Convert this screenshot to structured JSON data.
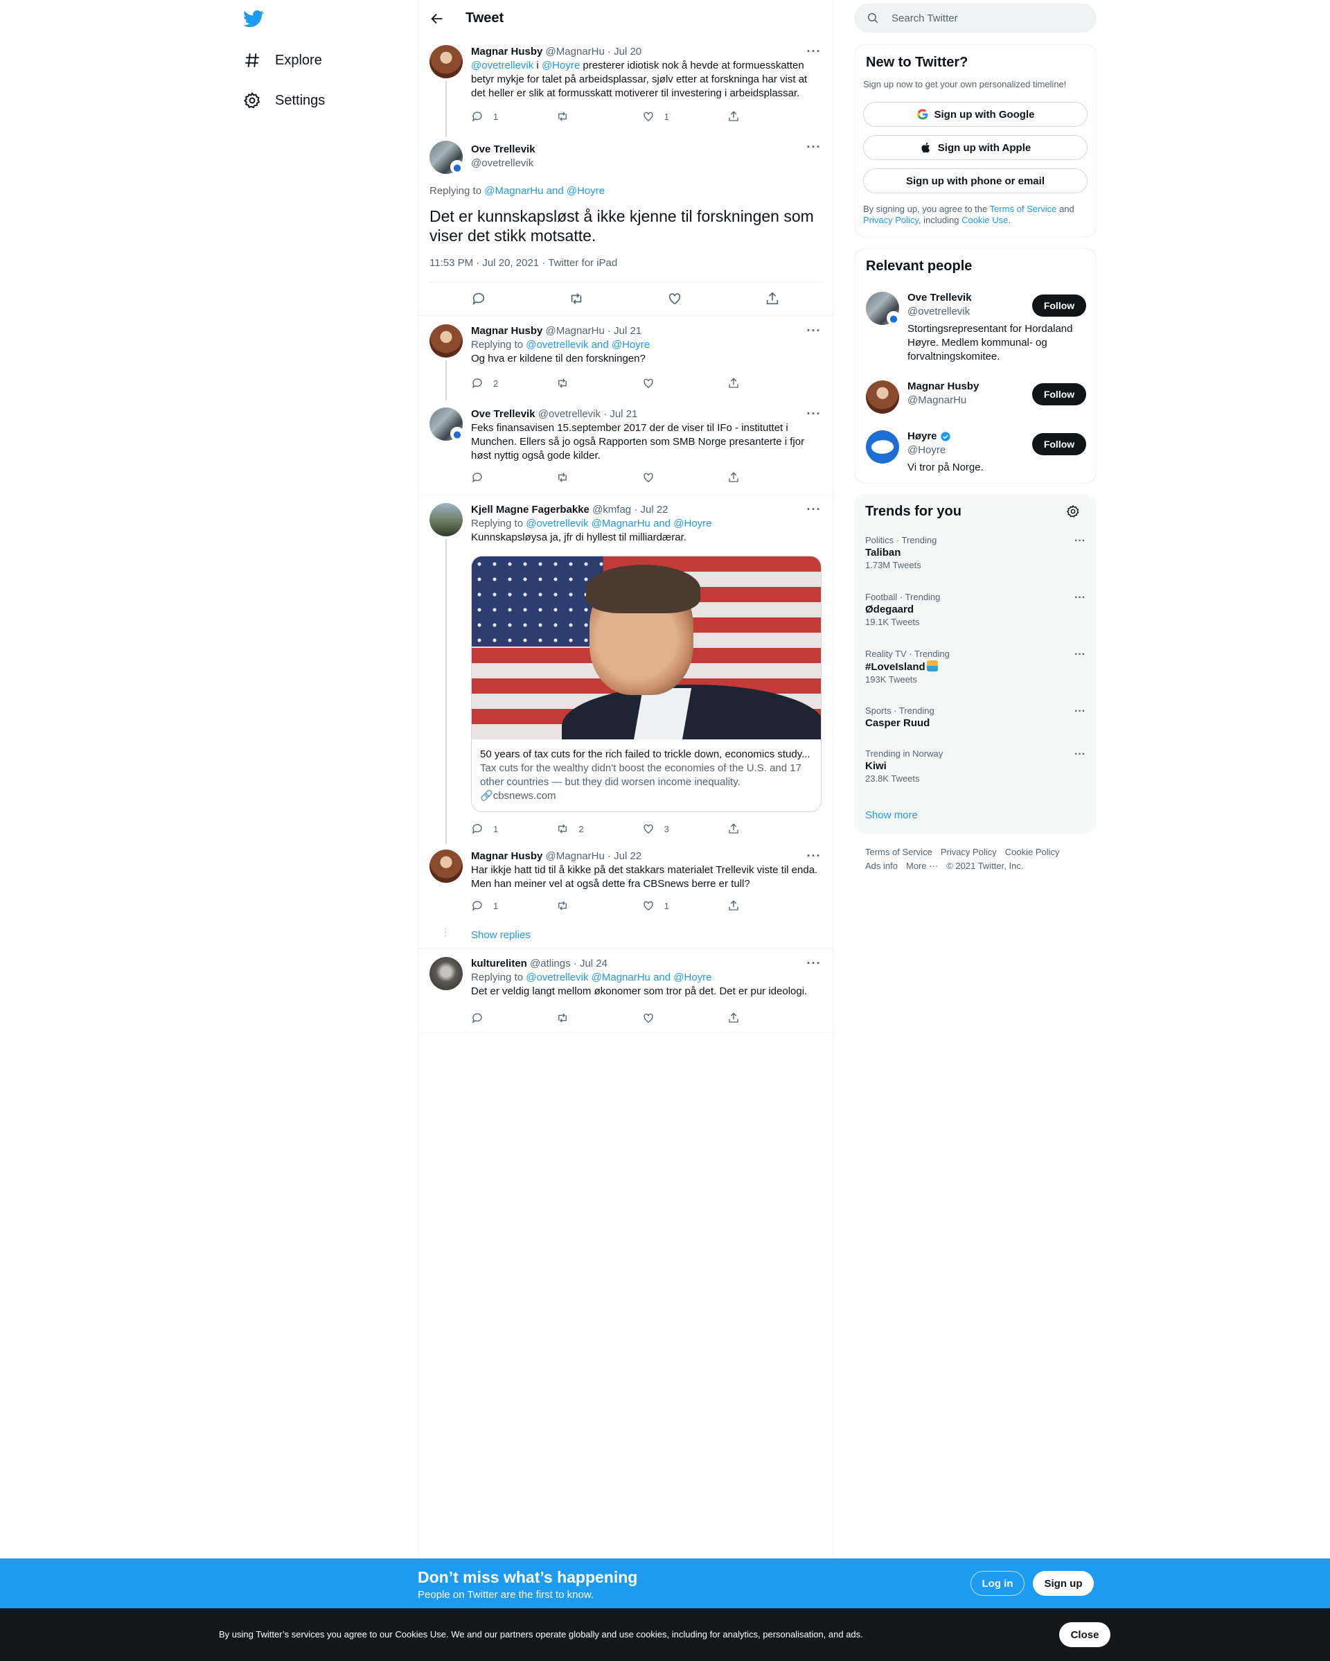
{
  "nav": {
    "explore_label": "Explore",
    "settings_label": "Settings"
  },
  "header": {
    "title": "Tweet"
  },
  "tweets": {
    "t1": {
      "name": "Magnar Husby",
      "meta": "@MagnarHu · Jul 20",
      "mention1": "@ovetrellevik",
      "conj": " i ",
      "mention2": "@Hoyre",
      "text": " presterer idiotisk nok å hevde at formuesskatten betyr mykje for talet på arbeidsplassar, sjølv etter at forskninga har vist at det heller er slik at formusskatt motiverer til investering i arbeidsplassar.",
      "replies": "1",
      "retweets": "",
      "likes": "1"
    },
    "focus": {
      "name": "Ove Trellevik",
      "handle": "@ovetrellevik",
      "replying_prefix": "Replying to ",
      "replying_to": "@MagnarHu and @Hoyre",
      "text": "Det er kunnskapsløst å ikke kjenne til forskningen som viser det stikk motsatte.",
      "timestamp": "11:53 PM · Jul 20, 2021 · Twitter for iPad"
    },
    "t2": {
      "name": "Magnar Husby",
      "meta": "@MagnarHu · Jul 21",
      "replying_prefix": "Replying to ",
      "replying_to": "@ovetrellevik and @Hoyre",
      "text": "Og hva er kildene til den forskningen?",
      "replies": "2",
      "retweets": "",
      "likes": ""
    },
    "t3": {
      "name": "Ove Trellevik",
      "meta": "@ovetrellevik · Jul 21",
      "text": "Feks finansavisen 15.september 2017 der de viser til IFo - instituttet i Munchen. Ellers så jo også Rapporten som SMB Norge presanterte i fjor høst nyttig også gode kilder.",
      "replies": "",
      "retweets": "",
      "likes": ""
    },
    "t4": {
      "name": "Kjell Magne Fagerbakke",
      "meta": "@kmfag · Jul 22",
      "replying_prefix": "Replying to ",
      "replying_to": "@ovetrellevik @MagnarHu and @Hoyre",
      "text": "Kunnskapsløysa ja, jfr di hyllest til milliardærar.",
      "card_title": "50 years of tax cuts for the rich failed to trickle down, economics study...",
      "card_desc": "Tax cuts for the wealthy didn't boost the economies of the U.S. and 17 other countries — but they did worsen income inequality.",
      "card_domain": "cbsnews.com",
      "replies": "1",
      "retweets": "2",
      "likes": "3"
    },
    "t5": {
      "name": "Magnar Husby",
      "meta": "@MagnarHu · Jul 22",
      "text": "Har ikkje hatt tid til å kikke på det stakkars materialet Trellevik viste til enda. Men han meiner vel at også dette fra CBSnews berre er tull?",
      "replies": "1",
      "retweets": "",
      "likes": "1"
    },
    "show_replies": "Show replies",
    "t6": {
      "name": "kultureliten",
      "meta": "@atlings · Jul 24",
      "replying_prefix": "Replying to ",
      "replying_to": "@ovetrellevik @MagnarHu and @Hoyre",
      "text": "Det er veldig langt mellom økonomer som tror på det. Det er pur ideologi.",
      "replies": "",
      "retweets": "",
      "likes": ""
    }
  },
  "search": {
    "placeholder": "Search Twitter"
  },
  "new_to_twitter": {
    "title": "New to Twitter?",
    "subtitle": "Sign up now to get your own personalized timeline!",
    "google": "Sign up with Google",
    "apple": "Sign up with Apple",
    "phone": "Sign up with phone or email",
    "legal_1": "By signing up, you agree to the ",
    "tos": "Terms of Service",
    "legal_2": " and ",
    "privacy": "Privacy Policy",
    "legal_3": ", including ",
    "cookie": "Cookie Use",
    "legal_4": "."
  },
  "relevant": {
    "title": "Relevant people",
    "follow_label": "Follow",
    "people": [
      {
        "name": "Ove Trellevik",
        "handle": "@ovetrellevik",
        "bio": "Stortingsrepresentant for Hordaland Høyre. Medlem kommunal- og forvaltningskomitee."
      },
      {
        "name": "Magnar Husby",
        "handle": "@MagnarHu",
        "bio": ""
      },
      {
        "name": "Høyre",
        "handle": "@Hoyre",
        "bio": "Vi tror på Norge."
      }
    ]
  },
  "trends": {
    "title": "Trends for you",
    "items": [
      {
        "context": "Politics · Trending",
        "name": "Taliban",
        "count": "1.73M Tweets"
      },
      {
        "context": "Football · Trending",
        "name": "Ødegaard",
        "count": "19.1K Tweets"
      },
      {
        "context": "Reality TV · Trending",
        "name": "#LoveIsland",
        "count": "193K Tweets"
      },
      {
        "context": "Sports · Trending",
        "name": "Casper Ruud",
        "count": ""
      },
      {
        "context": "Trending in Norway",
        "name": "Kiwi",
        "count": "23.8K Tweets"
      }
    ],
    "show_more": "Show more"
  },
  "footer": {
    "tos": "Terms of Service",
    "privacy": "Privacy Policy",
    "cookie": "Cookie Policy",
    "ads": "Ads info",
    "more": "More ···",
    "copyright": "© 2021 Twitter, Inc."
  },
  "bottom_bar": {
    "headline": "Don’t miss what’s happening",
    "sub": "People on Twitter are the first to know.",
    "login": "Log in",
    "signup": "Sign up"
  },
  "cookie_bar": {
    "text": "By using Twitter’s services you agree to our Cookies Use. We and our partners operate globally and use cookies, including for analytics, personalisation, and ads.",
    "close": "Close"
  },
  "colors": {
    "accent": "#1d9bf0",
    "text_secondary": "#536471",
    "dark": "#0f1419"
  }
}
